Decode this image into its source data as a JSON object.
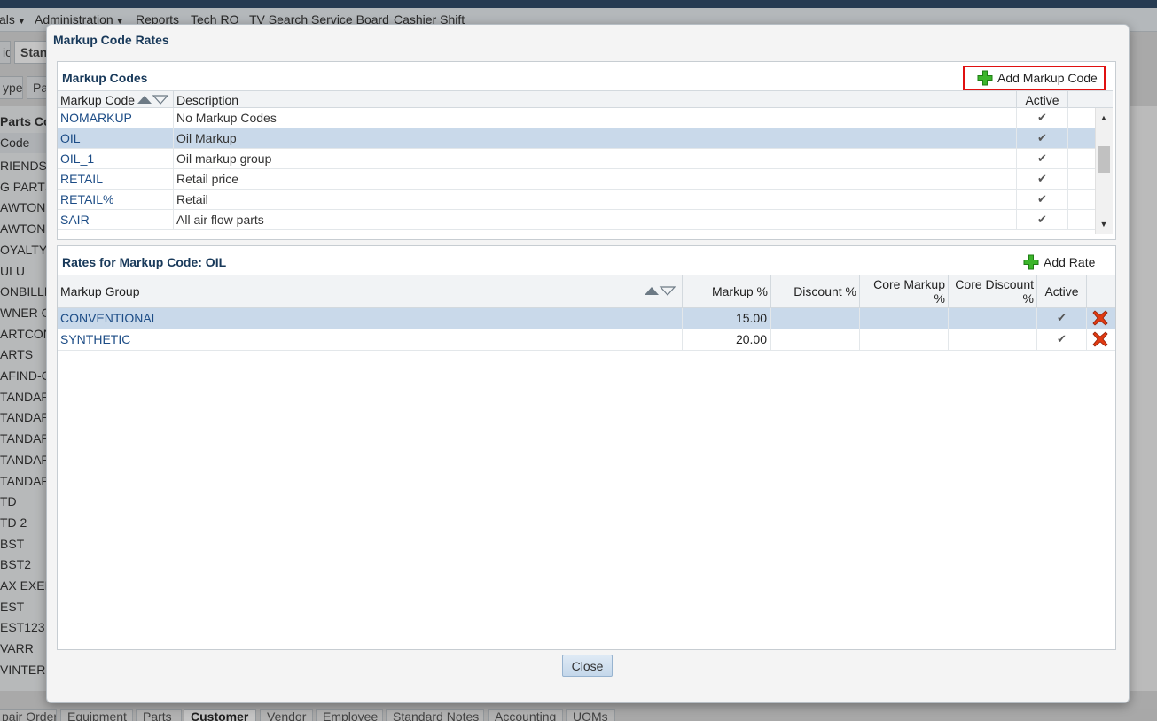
{
  "background": {
    "menu": [
      {
        "label": "als",
        "caret": true
      },
      {
        "label": "Administration",
        "caret": true
      },
      {
        "label": "Reports",
        "caret": false
      },
      {
        "label": "Tech RO",
        "caret": false
      },
      {
        "label": "TV Search Service Board",
        "caret": false
      },
      {
        "label": "Cashier Shift",
        "caret": false
      }
    ],
    "tabs": [
      "ic",
      "Stan"
    ],
    "subtabs": [
      "ype",
      "Pa"
    ],
    "list_title": "Parts Co",
    "list_header": "Code",
    "list_rows": [
      "RIENDSM",
      "G PARTS",
      "AWTONC",
      "AWTONC",
      "OYALTY",
      "ULU",
      "ONBILLI",
      "WNER O",
      "ARTCON",
      "ARTS",
      "AFIND-C",
      "TANDAR",
      "TANDAR",
      "TANDAR",
      "TANDAR",
      "TANDAR",
      "TD",
      "TD 2",
      "BST",
      "BST2",
      "AX EXEM",
      "EST",
      "EST123",
      "VARR",
      "VINTER"
    ],
    "bottom_tabs": [
      {
        "label": "pair Order",
        "selected": false
      },
      {
        "label": "Equipment",
        "selected": false
      },
      {
        "label": "Parts",
        "selected": false
      },
      {
        "label": "Customer",
        "selected": true
      },
      {
        "label": "Vendor",
        "selected": false
      },
      {
        "label": "Employee",
        "selected": false
      },
      {
        "label": "Standard Notes",
        "selected": false
      },
      {
        "label": "Accounting",
        "selected": false
      },
      {
        "label": "UOMs",
        "selected": false
      }
    ]
  },
  "dialog": {
    "title": "Markup Code Rates",
    "close_label": "Close"
  },
  "markup_codes": {
    "title": "Markup Codes",
    "add_label": "Add Markup Code",
    "columns": {
      "code": "Markup Code",
      "description": "Description",
      "active": "Active"
    },
    "rows": [
      {
        "code": "NOMARKUP",
        "description": "No Markup Codes",
        "active": "✔",
        "selected": false
      },
      {
        "code": "OIL",
        "description": "Oil Markup",
        "active": "✔",
        "selected": true
      },
      {
        "code": "OIL_1",
        "description": "Oil markup group",
        "active": "✔",
        "selected": false
      },
      {
        "code": "RETAIL",
        "description": "Retail price",
        "active": "✔",
        "selected": false
      },
      {
        "code": "RETAIL%",
        "description": "Retail",
        "active": "✔",
        "selected": false
      },
      {
        "code": "SAIR",
        "description": "All air flow parts",
        "active": "✔",
        "selected": false
      }
    ],
    "scroll_position": 0.33
  },
  "rates": {
    "title": "Rates for Markup Code: OIL",
    "add_label": "Add Rate",
    "columns": {
      "group": "Markup Group",
      "markup": "Markup %",
      "discount": "Discount %",
      "core_markup_1": "Core Markup",
      "core_markup_2": "%",
      "core_discount_1": "Core Discount",
      "core_discount_2": "%",
      "active": "Active"
    },
    "rows": [
      {
        "group": "CONVENTIONAL",
        "markup": "15.00",
        "discount": "",
        "core_markup": "",
        "core_discount": "",
        "active": "✔",
        "selected": true
      },
      {
        "group": "SYNTHETIC",
        "markup": "20.00",
        "discount": "",
        "core_markup": "",
        "core_discount": "",
        "active": "✔",
        "selected": false
      }
    ]
  },
  "colors": {
    "accent": "#18395a",
    "link": "#1c4c86",
    "selected_row": "#c9d9ea",
    "highlight": "#e01010",
    "plus_green": "#3bb52a",
    "delete_red": "#e03a12"
  },
  "icons": {
    "add": "plus-icon",
    "delete": "delete-x-icon",
    "sort": "sort-arrows-icon",
    "active": "checkmark-icon"
  }
}
